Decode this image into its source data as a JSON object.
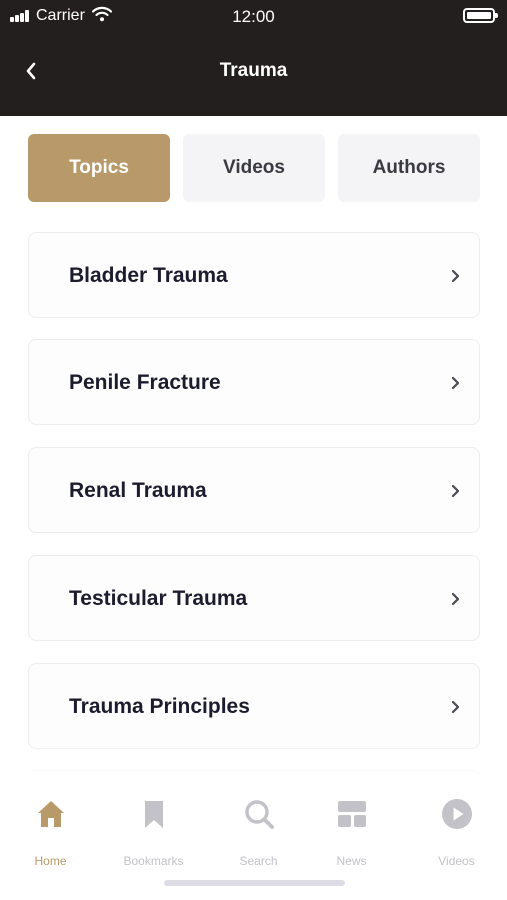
{
  "status_bar": {
    "carrier": "Carrier",
    "time": "12:00"
  },
  "header": {
    "title": "Trauma",
    "back_icon": "chevron-left-icon"
  },
  "tabs": [
    {
      "label": "Topics",
      "active": true
    },
    {
      "label": "Videos",
      "active": false
    },
    {
      "label": "Authors",
      "active": false
    }
  ],
  "topics": [
    {
      "label": "Bladder Trauma"
    },
    {
      "label": "Penile Fracture"
    },
    {
      "label": "Renal Trauma"
    },
    {
      "label": "Testicular Trauma"
    },
    {
      "label": "Trauma Principles"
    }
  ],
  "tab_bar": [
    {
      "label": "Home",
      "icon": "home-icon",
      "active": true
    },
    {
      "label": "Bookmarks",
      "icon": "bookmark-icon",
      "active": false
    },
    {
      "label": "Search",
      "icon": "search-icon",
      "active": false
    },
    {
      "label": "News",
      "icon": "news-icon",
      "active": false
    },
    {
      "label": "Videos",
      "icon": "play-icon",
      "active": false
    }
  ],
  "colors": {
    "header_bg": "#241f1f",
    "accent": "#b89a6a",
    "inactive_tab_bg": "#f4f4f6",
    "text_dark": "#1c1c2e",
    "inactive_icon": "#c2c2c8"
  }
}
